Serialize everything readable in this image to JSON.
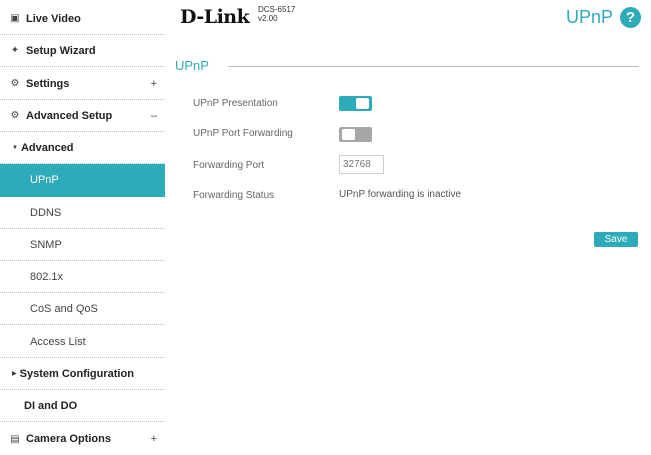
{
  "brand": {
    "logo": "D-Link",
    "model": "DCS-6517",
    "version": "v2.00"
  },
  "header": {
    "title": "UPnP",
    "help_glyph": "?"
  },
  "sidebar": {
    "live_video": "Live Video",
    "setup_wizard": "Setup Wizard",
    "settings": "Settings",
    "settings_toggle": "+",
    "advanced_setup": "Advanced Setup",
    "advanced_setup_toggle": "–",
    "advanced": "Advanced",
    "upnp": "UPnP",
    "ddns": "DDNS",
    "snmp": "SNMP",
    "dot1x": "802.1x",
    "cos_qos": "CoS and QoS",
    "access_list": "Access List",
    "system_configuration": "System Configuration",
    "di_do": "DI and DO",
    "camera_options": "Camera Options",
    "camera_options_toggle": "+"
  },
  "main": {
    "section_title": "UPnP",
    "presentation_label": "UPnP Presentation",
    "presentation_enabled": true,
    "port_forwarding_label": "UPnP Port Forwarding",
    "port_forwarding_enabled": false,
    "forwarding_port_label": "Forwarding Port",
    "forwarding_port_placeholder": "32768",
    "forwarding_status_label": "Forwarding Status",
    "forwarding_status_value": "UPnP forwarding is inactive",
    "save_label": "Save"
  },
  "colors": {
    "accent": "#2eabb9",
    "toggle_off": "#a7a7a7"
  }
}
